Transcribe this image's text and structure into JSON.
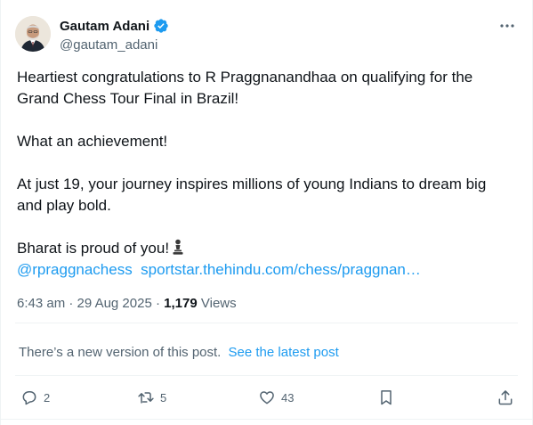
{
  "author": {
    "name": "Gautam Adani",
    "handle": "@gautam_adani",
    "verified": true,
    "verified_color": "#1d9bf0"
  },
  "post": {
    "line1": "Heartiest congratulations to R Praggnanandhaa on qualifying for the Grand Chess Tour Final in Brazil!",
    "line2": "What an achievement!",
    "line3": "At just 19, your journey inspires millions of young Indians to dream big and play bold.",
    "line4": "Bharat is proud of you!",
    "emoji": "pawn-icon",
    "mention": "@rpraggnachess",
    "link": "sportstar.thehindu.com/chess/praggnan…"
  },
  "meta": {
    "time": "6:43 am",
    "separator": "·",
    "date": "29 Aug 2025",
    "views_count": "1,179",
    "views_label": "Views"
  },
  "notice": {
    "text": "There’s a new version of this post.",
    "link": "See the latest post"
  },
  "actions": {
    "replies": "2",
    "reposts": "5",
    "likes": "43"
  },
  "colors": {
    "link": "#1d9bf0",
    "muted": "#536471",
    "text": "#0f1419",
    "divider": "#eff3f4"
  }
}
